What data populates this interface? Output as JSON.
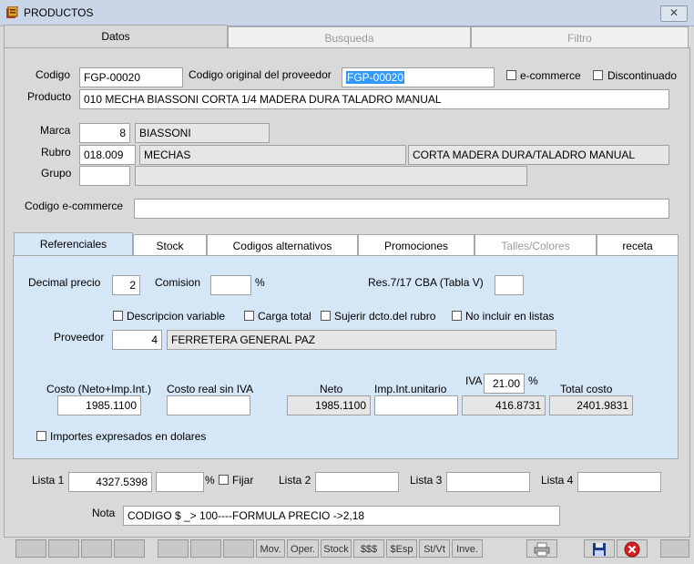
{
  "window": {
    "title": "PRODUCTOS",
    "close": "✕"
  },
  "main_tabs": [
    {
      "label": "Datos"
    },
    {
      "label": "Busqueda"
    },
    {
      "label": "Filtro"
    }
  ],
  "product": {
    "codigo_label": "Codigo",
    "codigo_value": "FGP-00020",
    "codigo_orig_label": "Codigo original del proveedor",
    "codigo_orig_value": "FGP-00020",
    "ecommerce_label": "e-commerce",
    "discontinuado_label": "Discontinuado",
    "producto_label": "Producto",
    "producto_value": "010 MECHA BIASSONI CORTA  1/4  MADERA DURA TALADRO MANUAL",
    "marca_label": "Marca",
    "marca_code": "8",
    "marca_name": "BIASSONI",
    "rubro_label": "Rubro",
    "rubro_code": "018.009",
    "rubro_name": "MECHAS",
    "rubro_sub": "CORTA MADERA DURA/TALADRO MANUAL",
    "grupo_label": "Grupo",
    "grupo_code": "",
    "grupo_name": "",
    "codigo_ecom_label": "Codigo e-commerce",
    "codigo_ecom_value": ""
  },
  "inner_tabs": [
    {
      "label": "Referenciales"
    },
    {
      "label": "Stock"
    },
    {
      "label": "Codigos alternativos"
    },
    {
      "label": "Promociones"
    },
    {
      "label": "Talles/Colores"
    },
    {
      "label": "receta"
    }
  ],
  "referenciales": {
    "decimal_precio_label": "Decimal precio",
    "decimal_precio_value": "2",
    "comision_label": "Comision",
    "comision_value": "",
    "percent": "%",
    "res_label": "Res.7/17 CBA (Tabla V)",
    "res_value": "",
    "desc_variable_label": "Descripcion variable",
    "carga_total_label": "Carga total",
    "sujerir_label": "Sujerir dcto.del rubro",
    "no_incluir_label": "No incluir en listas",
    "proveedor_label": "Proveedor",
    "proveedor_code": "4",
    "proveedor_name": "FERRETERA GENERAL PAZ",
    "costo_label": "Costo (Neto+Imp.Int.)",
    "costo_value": "1985.1100",
    "costo_real_label": "Costo real sin IVA",
    "costo_real_value": "",
    "neto_label": "Neto",
    "neto_value": "1985.1100",
    "imp_int_label": "Imp.Int.unitario",
    "imp_int_value": "",
    "iva_label": "IVA",
    "iva_rate": "21.00",
    "iva_value": "416.8731",
    "total_label": "Total costo",
    "total_value": "2401.9831",
    "dolares_label": "Importes expresados en dolares"
  },
  "listas": {
    "lista1_label": "Lista 1",
    "lista1_value": "4327.5398",
    "lista1_pct": "",
    "percent": "%",
    "fijar_label": "Fijar",
    "lista2_label": "Lista 2",
    "lista2_value": "",
    "lista3_label": "Lista 3",
    "lista3_value": "",
    "lista4_label": "Lista 4",
    "lista4_value": "",
    "nota_label": "Nota",
    "nota_value": "CODIGO $ _> 100----FORMULA PRECIO  ->2,18"
  },
  "toolbar": {
    "mov": "Mov.",
    "oper": "Oper.",
    "stock": "Stock",
    "sss": "$$$",
    "sesp": "$Esp",
    "stvt": "St/Vt",
    "inve": "Inve."
  },
  "colors": {
    "selection": "#3399ff",
    "inner_panel": "#d5e6f6",
    "save_icon": "#1a3a8a",
    "cancel_icon": "#d42020"
  }
}
